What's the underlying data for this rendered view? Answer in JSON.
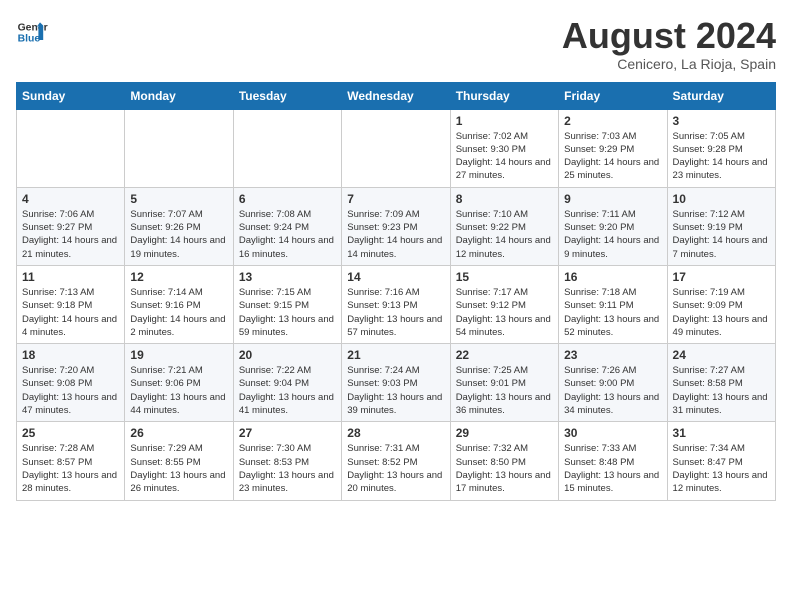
{
  "logo": {
    "line1": "General",
    "line2": "Blue"
  },
  "title": "August 2024",
  "subtitle": "Cenicero, La Rioja, Spain",
  "days_of_week": [
    "Sunday",
    "Monday",
    "Tuesday",
    "Wednesday",
    "Thursday",
    "Friday",
    "Saturday"
  ],
  "weeks": [
    [
      {
        "day": "",
        "info": ""
      },
      {
        "day": "",
        "info": ""
      },
      {
        "day": "",
        "info": ""
      },
      {
        "day": "",
        "info": ""
      },
      {
        "day": "1",
        "info": "Sunrise: 7:02 AM\nSunset: 9:30 PM\nDaylight: 14 hours and 27 minutes."
      },
      {
        "day": "2",
        "info": "Sunrise: 7:03 AM\nSunset: 9:29 PM\nDaylight: 14 hours and 25 minutes."
      },
      {
        "day": "3",
        "info": "Sunrise: 7:05 AM\nSunset: 9:28 PM\nDaylight: 14 hours and 23 minutes."
      }
    ],
    [
      {
        "day": "4",
        "info": "Sunrise: 7:06 AM\nSunset: 9:27 PM\nDaylight: 14 hours and 21 minutes."
      },
      {
        "day": "5",
        "info": "Sunrise: 7:07 AM\nSunset: 9:26 PM\nDaylight: 14 hours and 19 minutes."
      },
      {
        "day": "6",
        "info": "Sunrise: 7:08 AM\nSunset: 9:24 PM\nDaylight: 14 hours and 16 minutes."
      },
      {
        "day": "7",
        "info": "Sunrise: 7:09 AM\nSunset: 9:23 PM\nDaylight: 14 hours and 14 minutes."
      },
      {
        "day": "8",
        "info": "Sunrise: 7:10 AM\nSunset: 9:22 PM\nDaylight: 14 hours and 12 minutes."
      },
      {
        "day": "9",
        "info": "Sunrise: 7:11 AM\nSunset: 9:20 PM\nDaylight: 14 hours and 9 minutes."
      },
      {
        "day": "10",
        "info": "Sunrise: 7:12 AM\nSunset: 9:19 PM\nDaylight: 14 hours and 7 minutes."
      }
    ],
    [
      {
        "day": "11",
        "info": "Sunrise: 7:13 AM\nSunset: 9:18 PM\nDaylight: 14 hours and 4 minutes."
      },
      {
        "day": "12",
        "info": "Sunrise: 7:14 AM\nSunset: 9:16 PM\nDaylight: 14 hours and 2 minutes."
      },
      {
        "day": "13",
        "info": "Sunrise: 7:15 AM\nSunset: 9:15 PM\nDaylight: 13 hours and 59 minutes."
      },
      {
        "day": "14",
        "info": "Sunrise: 7:16 AM\nSunset: 9:13 PM\nDaylight: 13 hours and 57 minutes."
      },
      {
        "day": "15",
        "info": "Sunrise: 7:17 AM\nSunset: 9:12 PM\nDaylight: 13 hours and 54 minutes."
      },
      {
        "day": "16",
        "info": "Sunrise: 7:18 AM\nSunset: 9:11 PM\nDaylight: 13 hours and 52 minutes."
      },
      {
        "day": "17",
        "info": "Sunrise: 7:19 AM\nSunset: 9:09 PM\nDaylight: 13 hours and 49 minutes."
      }
    ],
    [
      {
        "day": "18",
        "info": "Sunrise: 7:20 AM\nSunset: 9:08 PM\nDaylight: 13 hours and 47 minutes."
      },
      {
        "day": "19",
        "info": "Sunrise: 7:21 AM\nSunset: 9:06 PM\nDaylight: 13 hours and 44 minutes."
      },
      {
        "day": "20",
        "info": "Sunrise: 7:22 AM\nSunset: 9:04 PM\nDaylight: 13 hours and 41 minutes."
      },
      {
        "day": "21",
        "info": "Sunrise: 7:24 AM\nSunset: 9:03 PM\nDaylight: 13 hours and 39 minutes."
      },
      {
        "day": "22",
        "info": "Sunrise: 7:25 AM\nSunset: 9:01 PM\nDaylight: 13 hours and 36 minutes."
      },
      {
        "day": "23",
        "info": "Sunrise: 7:26 AM\nSunset: 9:00 PM\nDaylight: 13 hours and 34 minutes."
      },
      {
        "day": "24",
        "info": "Sunrise: 7:27 AM\nSunset: 8:58 PM\nDaylight: 13 hours and 31 minutes."
      }
    ],
    [
      {
        "day": "25",
        "info": "Sunrise: 7:28 AM\nSunset: 8:57 PM\nDaylight: 13 hours and 28 minutes."
      },
      {
        "day": "26",
        "info": "Sunrise: 7:29 AM\nSunset: 8:55 PM\nDaylight: 13 hours and 26 minutes."
      },
      {
        "day": "27",
        "info": "Sunrise: 7:30 AM\nSunset: 8:53 PM\nDaylight: 13 hours and 23 minutes."
      },
      {
        "day": "28",
        "info": "Sunrise: 7:31 AM\nSunset: 8:52 PM\nDaylight: 13 hours and 20 minutes."
      },
      {
        "day": "29",
        "info": "Sunrise: 7:32 AM\nSunset: 8:50 PM\nDaylight: 13 hours and 17 minutes."
      },
      {
        "day": "30",
        "info": "Sunrise: 7:33 AM\nSunset: 8:48 PM\nDaylight: 13 hours and 15 minutes."
      },
      {
        "day": "31",
        "info": "Sunrise: 7:34 AM\nSunset: 8:47 PM\nDaylight: 13 hours and 12 minutes."
      }
    ]
  ]
}
